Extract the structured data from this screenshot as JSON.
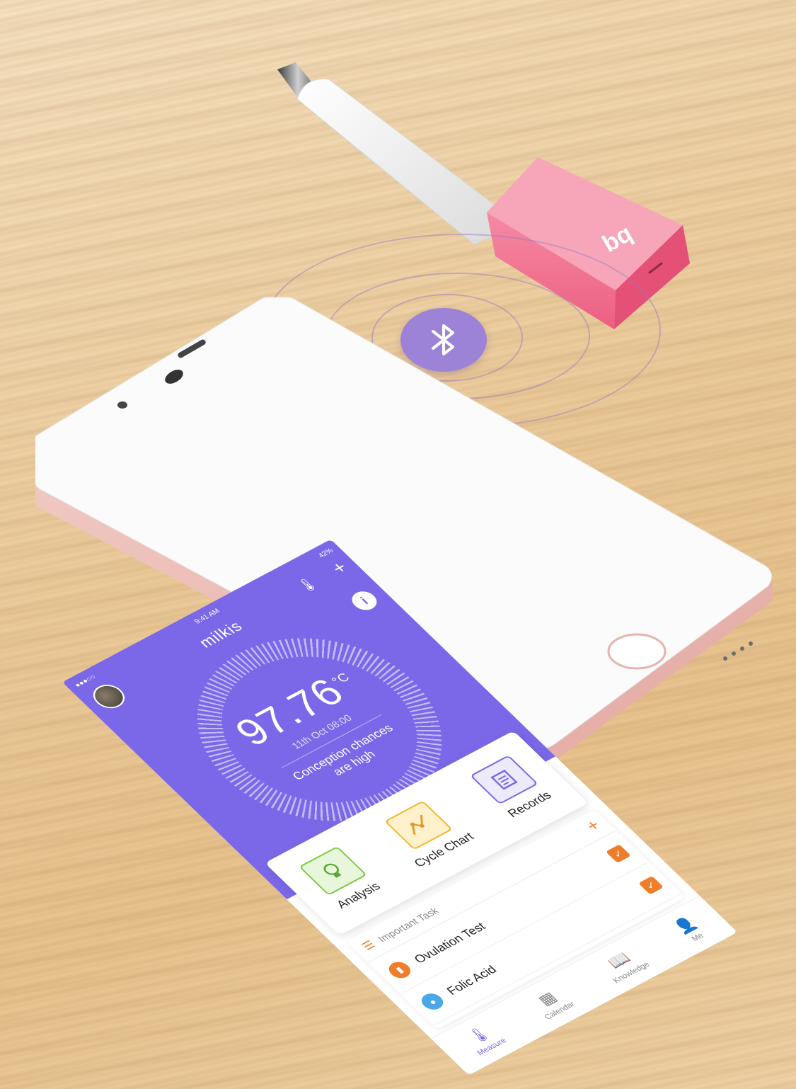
{
  "device_logo": "bq",
  "status_bar": {
    "carrier": "●●●○○",
    "time": "9:41 AM",
    "battery": "42%"
  },
  "header": {
    "title": "milkis"
  },
  "reading": {
    "temperature": "97.76",
    "unit": "°C",
    "date": "11th Oct 08:00",
    "message_line1": "Conception chances",
    "message_line2": "are high"
  },
  "features": [
    {
      "label": "Analysis",
      "icon": "bulb-icon"
    },
    {
      "label": "Cycle Chart",
      "icon": "chart-icon"
    },
    {
      "label": "Records",
      "icon": "notes-icon"
    }
  ],
  "tasks": {
    "heading": "Important Task",
    "items": [
      {
        "label": "Ovulation Test",
        "color": "#f07d2a"
      },
      {
        "label": "Folic Acid",
        "color": "#4aa8e8"
      }
    ]
  },
  "tabs": [
    {
      "label": "Measure",
      "icon": "thermometer-icon",
      "active": true
    },
    {
      "label": "Calendar",
      "icon": "calendar-icon",
      "active": false
    },
    {
      "label": "Knowledge",
      "icon": "book-icon",
      "active": false
    },
    {
      "label": "Me",
      "icon": "person-icon",
      "active": false
    }
  ],
  "colors": {
    "primary": "#7b68e8",
    "accent": "#f07d2a",
    "device_pink": "#f06a8e"
  }
}
